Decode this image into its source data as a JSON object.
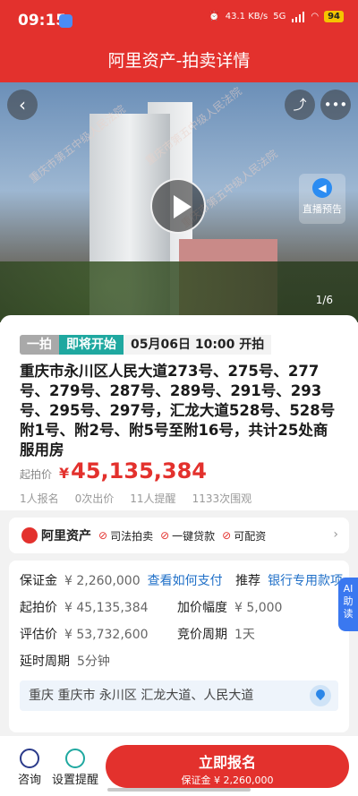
{
  "status_bar": {
    "time": "09:15",
    "net_speed": "43.1 KB/s",
    "network": "5G",
    "battery": "94"
  },
  "header": {
    "title": "阿里资产-拍卖详情"
  },
  "hero": {
    "watermark": "重庆市第五中级人民法院",
    "live_label": "直播预告",
    "page_indicator": "1/6"
  },
  "auction": {
    "round_tag": "一拍",
    "status_tag": "即将开始",
    "start_date": "05月06日 10:00",
    "start_suffix": "开拍",
    "title": "重庆市永川区人民大道273号、275号、277号、279号、287号、289号、291号、293号、295号、297号，汇龙大道528号、528号附1号、附2号、附5号至附16号，共计25处商服用房",
    "price_label": "起拍价",
    "currency": "¥",
    "starting_price": "45,135,384",
    "stats": [
      "1人报名",
      "0次出价",
      "11人提醒",
      "1133次围观"
    ]
  },
  "brand_bar": {
    "name": "阿里资产",
    "features": [
      "司法拍卖",
      "一键贷款",
      "可配资"
    ]
  },
  "details": {
    "deposit_label": "保证金",
    "deposit_value": "¥ 2,260,000",
    "deposit_link": "查看如何支付",
    "recommend_label": "推荐",
    "recommend_link": "银行专用款项",
    "start_price_label": "起拍价",
    "start_price_value": "¥ 45,135,384",
    "increment_label": "加价幅度",
    "increment_value": "¥ 5,000",
    "appraisal_label": "评估价",
    "appraisal_value": "¥ 53,732,600",
    "period_label": "竞价周期",
    "period_value": "1天",
    "delay_label": "延时周期",
    "delay_value": "5分钟",
    "address": "重庆 重庆市 永川区 汇龙大道、人民大道"
  },
  "ai_badge": {
    "line1": "AI",
    "line2": "助",
    "line3": "读"
  },
  "bottom_bar": {
    "consult": "咨询",
    "remind": "设置提醒",
    "register_main": "立即报名",
    "register_sub": "保证金 ¥ 2,260,000"
  },
  "colors": {
    "primary": "#e3312d",
    "teal": "#1fa8a0",
    "link": "#2070c8"
  }
}
